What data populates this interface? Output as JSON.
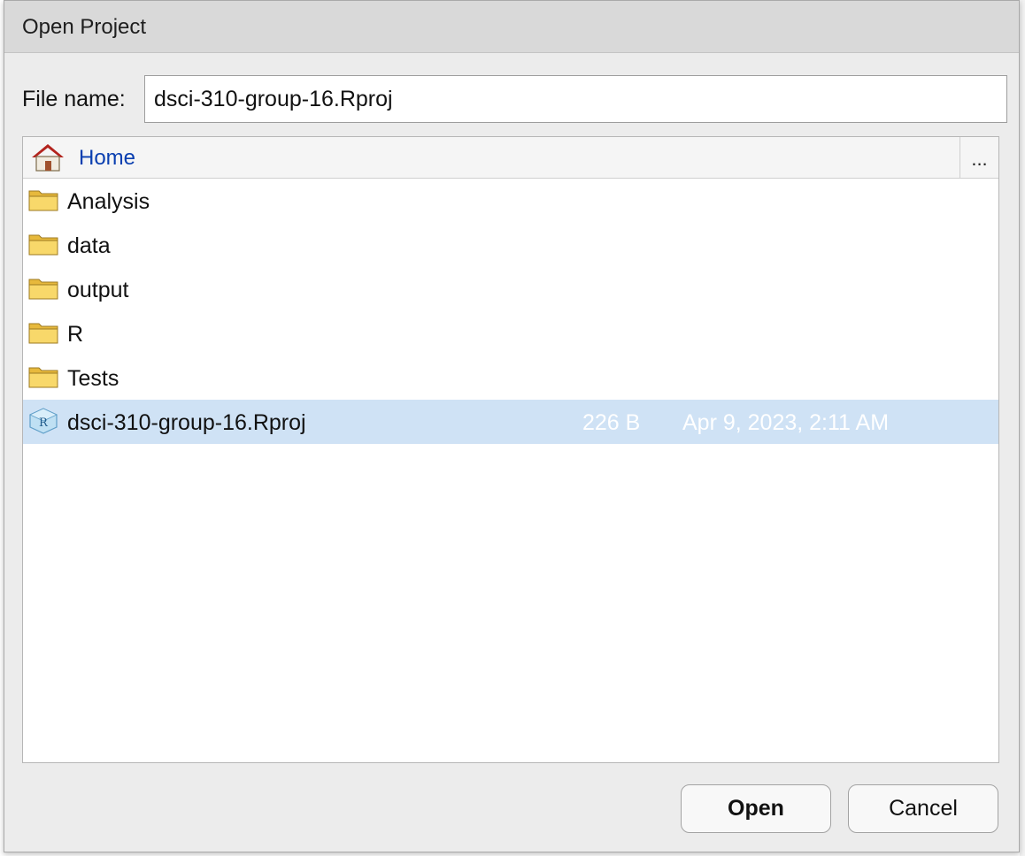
{
  "dialog": {
    "title": "Open Project",
    "file_name_label": "File name:",
    "file_name_value": "dsci-310-group-16.Rproj"
  },
  "browser": {
    "breadcrumb_home": "Home",
    "more_label": "...",
    "items": [
      {
        "name": "Analysis",
        "type": "folder",
        "size": "",
        "modified": ""
      },
      {
        "name": "data",
        "type": "folder",
        "size": "",
        "modified": ""
      },
      {
        "name": "output",
        "type": "folder",
        "size": "",
        "modified": ""
      },
      {
        "name": "R",
        "type": "folder",
        "size": "",
        "modified": ""
      },
      {
        "name": "Tests",
        "type": "folder",
        "size": "",
        "modified": ""
      },
      {
        "name": "dsci-310-group-16.Rproj",
        "type": "rproj-file",
        "size": "226 B",
        "modified": "Apr 9, 2023, 2:11 AM",
        "selected": true
      }
    ]
  },
  "buttons": {
    "open_label": "Open",
    "cancel_label": "Cancel"
  },
  "colors": {
    "selection": "#cfe2f5",
    "link": "#0a3fb0",
    "titlebar": "#d9d9d9"
  }
}
